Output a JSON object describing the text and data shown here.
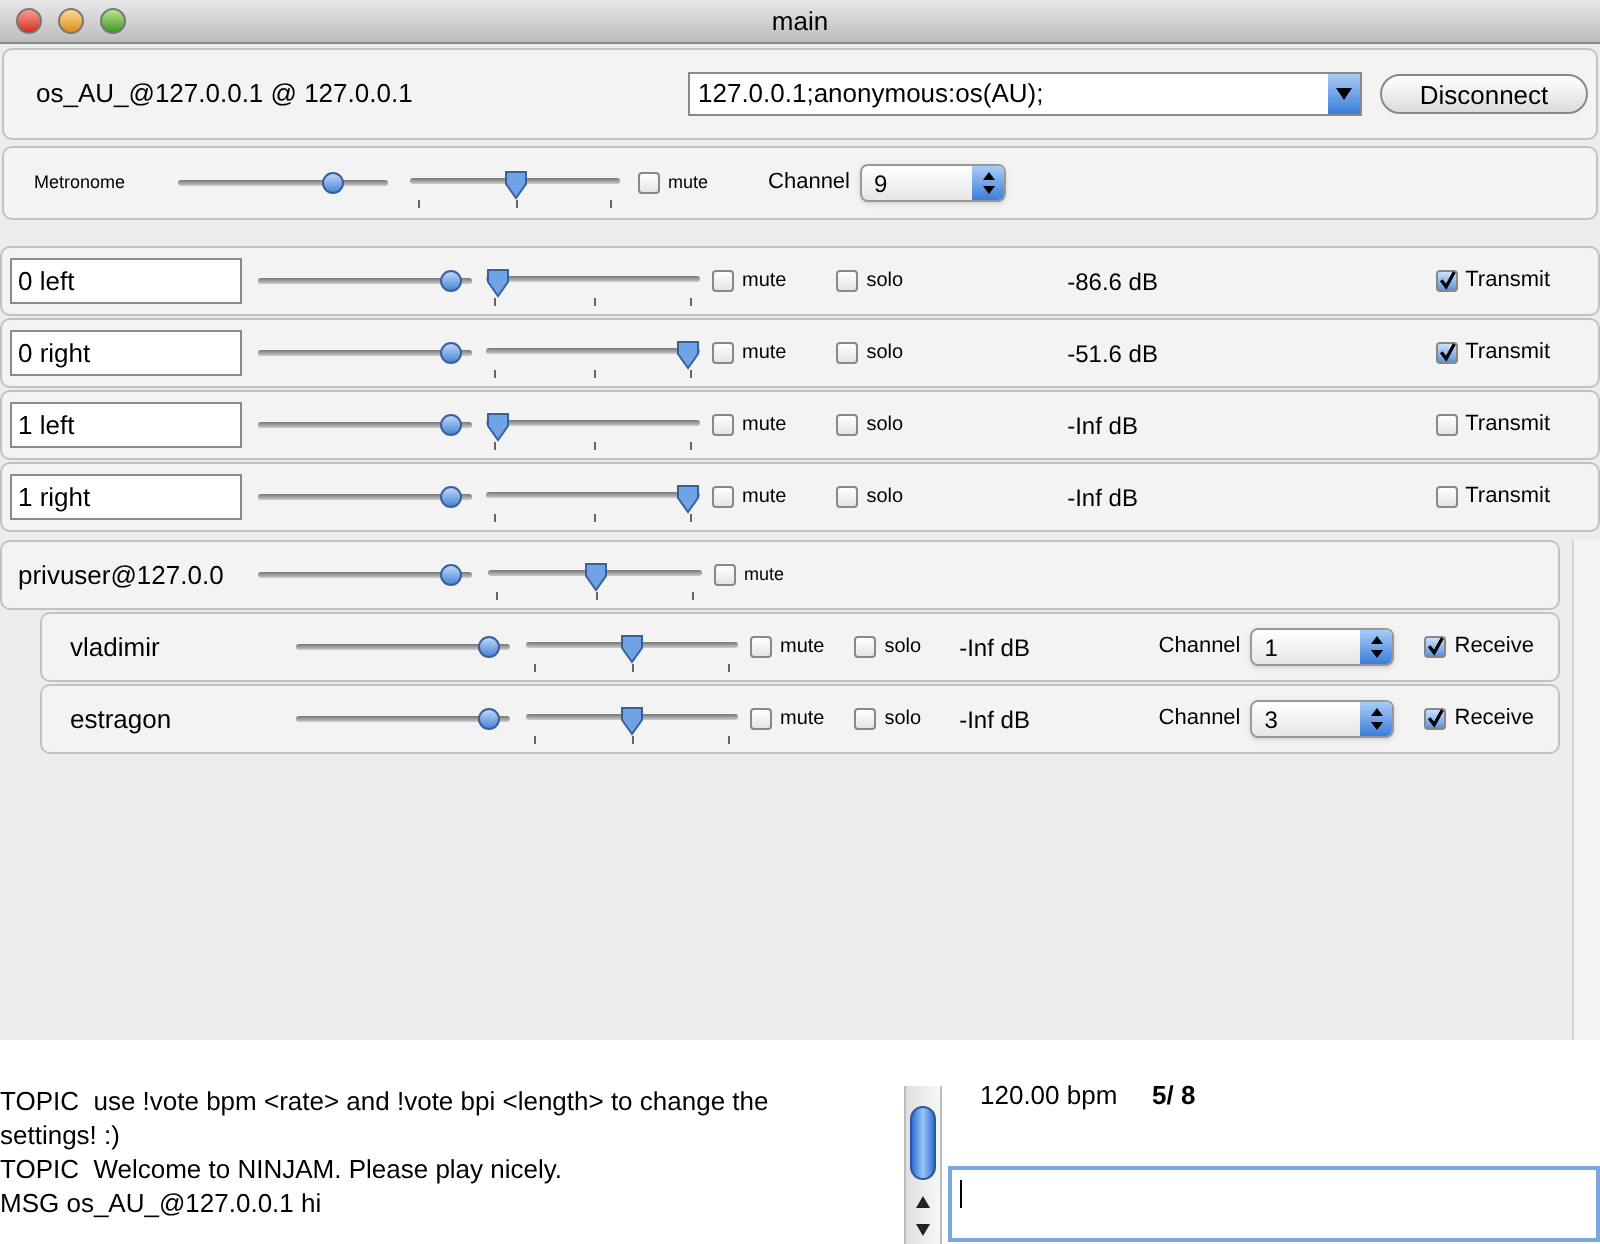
{
  "window": {
    "title": "main"
  },
  "connection": {
    "status": "os_AU_@127.0.0.1 @ 127.0.0.1",
    "server": "127.0.0.1;anonymous:os(AU);",
    "button": "Disconnect"
  },
  "metronome": {
    "label": "Metronome",
    "volume": {
      "level": 0.77
    },
    "pan": {
      "level": 0.5
    },
    "mute": {
      "label": "mute",
      "checked": false
    },
    "channel_label": "Channel",
    "channel": "9"
  },
  "local_channels": [
    {
      "name": "0 left",
      "volume": {
        "level": 0.95
      },
      "pan": {
        "level": 0.0
      },
      "mute": {
        "label": "mute",
        "checked": false
      },
      "solo": {
        "label": "solo",
        "checked": false
      },
      "reading": "-86.6 dB",
      "transmit": {
        "label": "Transmit",
        "checked": true
      }
    },
    {
      "name": "0 right",
      "volume": {
        "level": 0.95
      },
      "pan": {
        "level": 1.0
      },
      "mute": {
        "label": "mute",
        "checked": false
      },
      "solo": {
        "label": "solo",
        "checked": false
      },
      "reading": "-51.6 dB",
      "transmit": {
        "label": "Transmit",
        "checked": true
      }
    },
    {
      "name": "1 left",
      "volume": {
        "level": 0.95
      },
      "pan": {
        "level": 0.0
      },
      "mute": {
        "label": "mute",
        "checked": false
      },
      "solo": {
        "label": "solo",
        "checked": false
      },
      "reading": "-Inf dB",
      "transmit": {
        "label": "Transmit",
        "checked": false
      }
    },
    {
      "name": "1 right",
      "volume": {
        "level": 0.95
      },
      "pan": {
        "level": 1.0
      },
      "mute": {
        "label": "mute",
        "checked": false
      },
      "solo": {
        "label": "solo",
        "checked": false
      },
      "reading": "-Inf dB",
      "transmit": {
        "label": "Transmit",
        "checked": false
      }
    }
  ],
  "remote_users": [
    {
      "name": "privuser@127.0.0",
      "volume": {
        "level": 0.95
      },
      "pan": {
        "level": 0.5
      },
      "mute": {
        "label": "mute",
        "checked": false
      },
      "channels": [
        {
          "name": "vladimir",
          "volume": {
            "level": 0.95
          },
          "pan": {
            "level": 0.5
          },
          "mute": {
            "label": "mute",
            "checked": false
          },
          "solo": {
            "label": "solo",
            "checked": false
          },
          "reading": "-Inf dB",
          "channel_label": "Channel",
          "channel": "1",
          "receive": {
            "label": "Receive",
            "checked": true
          }
        },
        {
          "name": "estragon",
          "volume": {
            "level": 0.95
          },
          "pan": {
            "level": 0.5
          },
          "mute": {
            "label": "mute",
            "checked": false
          },
          "solo": {
            "label": "solo",
            "checked": false
          },
          "reading": "-Inf dB",
          "channel_label": "Channel",
          "channel": "3",
          "receive": {
            "label": "Receive",
            "checked": true
          }
        }
      ]
    }
  ],
  "chat": {
    "messages": [
      "TOPIC  use !vote bpm <rate> and !vote bpi <length> to change the settings! :)",
      "TOPIC  Welcome to NINJAM. Please play nicely.",
      "MSG os_AU_@127.0.0.1 hi"
    ]
  },
  "status": {
    "bpm": "120.00 bpm",
    "beat": "5/ 8"
  }
}
